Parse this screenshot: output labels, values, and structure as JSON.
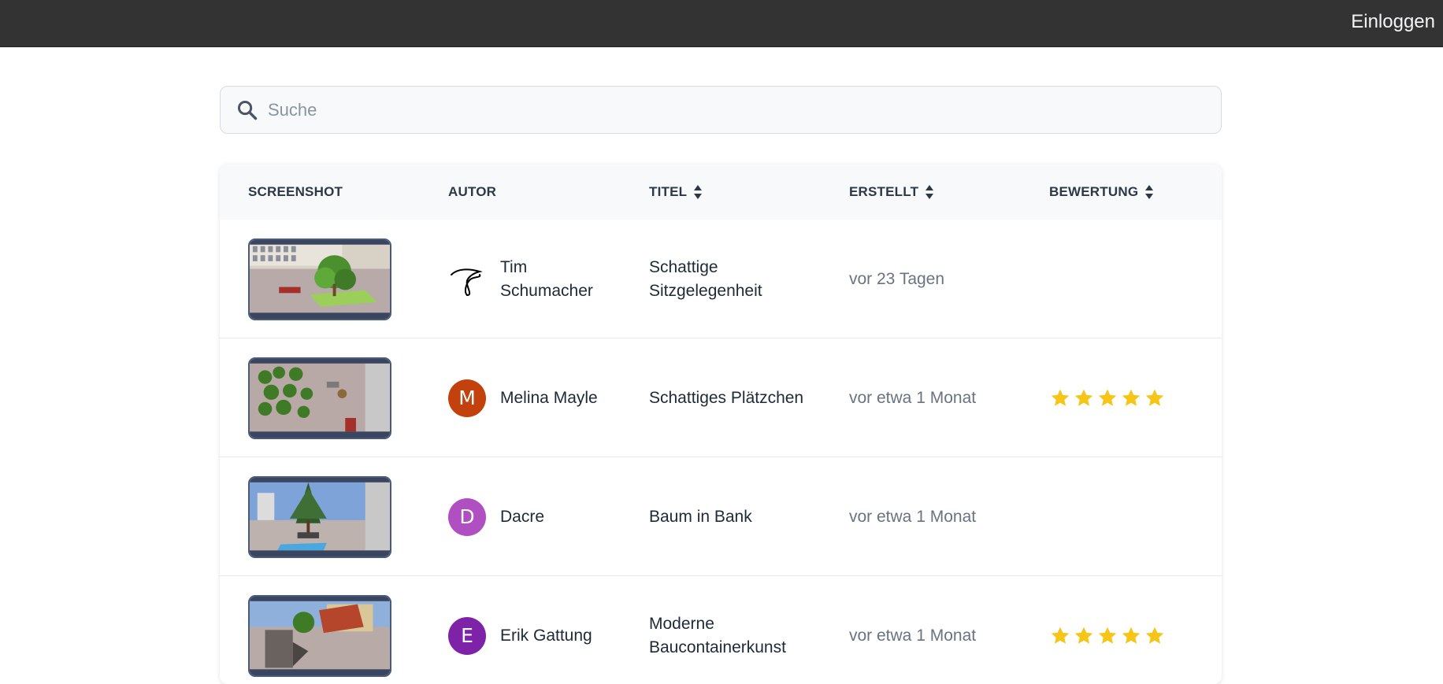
{
  "header": {
    "login_label": "Einloggen"
  },
  "search": {
    "placeholder": "Suche",
    "value": ""
  },
  "table": {
    "columns": [
      {
        "label": "SCREENSHOT",
        "sortable": false
      },
      {
        "label": "AUTOR",
        "sortable": false
      },
      {
        "label": "TITEL",
        "sortable": true
      },
      {
        "label": "ERSTELLT",
        "sortable": true
      },
      {
        "label": "BEWERTUNG",
        "sortable": true
      }
    ],
    "rows": [
      {
        "screenshot_icon": "thumbnail-image",
        "author": {
          "name": "Tim Schumacher",
          "avatar_type": "signature",
          "initial": "",
          "color": "#000000"
        },
        "title": "Schattige Sitzgelegenheit",
        "created": "vor 23 Tagen",
        "rating": 0
      },
      {
        "screenshot_icon": "thumbnail-image",
        "author": {
          "name": "Melina Mayle",
          "avatar_type": "initial",
          "initial": "M",
          "color": "#c2410c"
        },
        "title": "Schattiges Plätzchen",
        "created": "vor etwa 1 Monat",
        "rating": 5
      },
      {
        "screenshot_icon": "thumbnail-image",
        "author": {
          "name": "Dacre",
          "avatar_type": "initial",
          "initial": "D",
          "color": "#b04fc1"
        },
        "title": "Baum in Bank",
        "created": "vor etwa 1 Monat",
        "rating": 0
      },
      {
        "screenshot_icon": "thumbnail-image",
        "author": {
          "name": "Erik Gattung",
          "avatar_type": "initial",
          "initial": "E",
          "color": "#7e22a8"
        },
        "title": "Moderne Baucontainerkunst",
        "created": "vor etwa 1 Monat",
        "rating": 5
      }
    ]
  },
  "colors": {
    "topbar": "#333333",
    "star": "#f5c518",
    "header_bg": "#f8f9fa"
  }
}
